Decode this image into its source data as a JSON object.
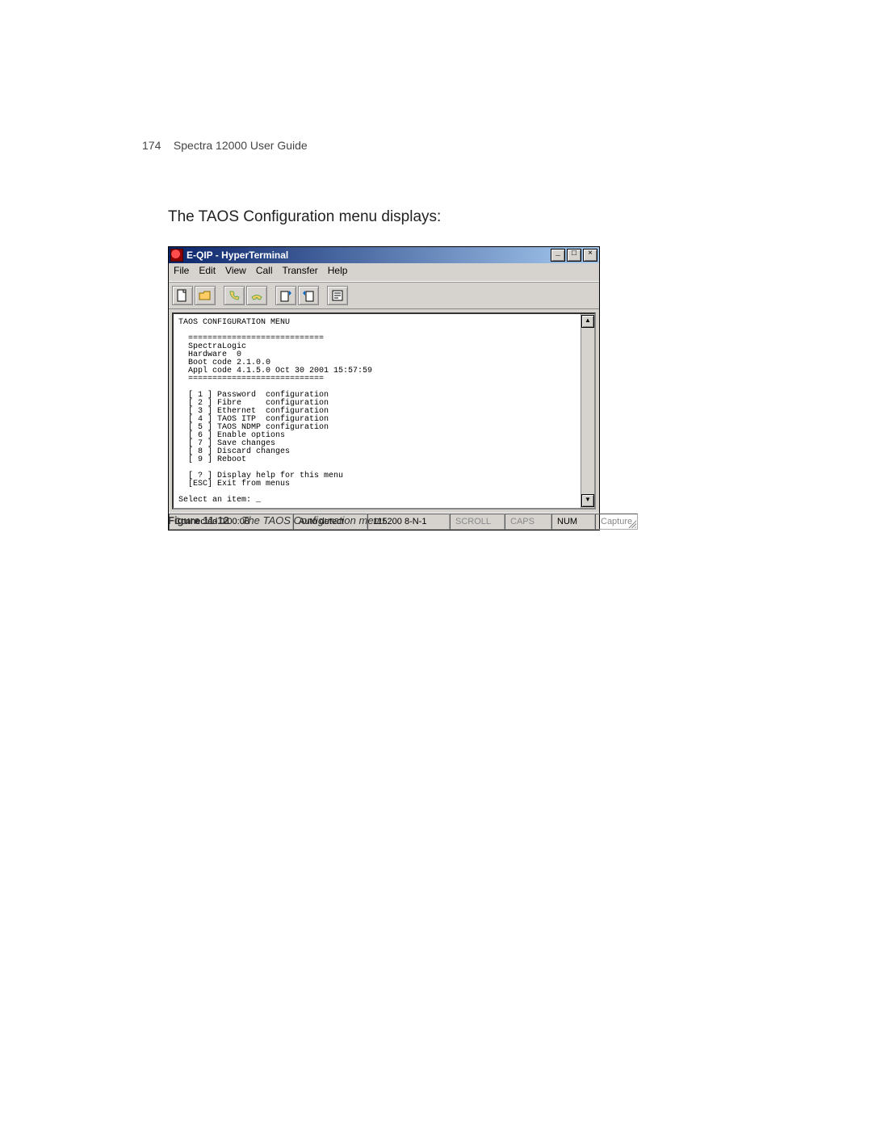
{
  "page": {
    "number": "174",
    "guide_title": "Spectra 12000 User Guide",
    "intro_text": "The TAOS Configuration menu displays:"
  },
  "window": {
    "title": "E-QIP - HyperTerminal",
    "menus": {
      "file": "File",
      "edit": "Edit",
      "view": "View",
      "call": "Call",
      "transfer": "Transfer",
      "help": "Help"
    },
    "titlebar_buttons": {
      "min": "_",
      "max": "□",
      "close": "×"
    },
    "scroll": {
      "up": "▲",
      "down": "▼"
    }
  },
  "terminal": {
    "text": "TAOS CONFIGURATION MENU\n\n  ============================\n  SpectraLogic\n  Hardware  0\n  Boot code 2.1.0.0\n  Appl code 4.1.5.0 Oct 30 2001 15:57:59\n  ============================\n\n  [ 1 ] Password  configuration\n  [ 2 ] Fibre     configuration\n  [ 3 ] Ethernet  configuration\n  [ 4 ] TAOS ITP  configuration\n  [ 5 ] TAOS NDMP configuration\n  [ 6 ] Enable options\n  [ 7 ] Save changes\n  [ 8 ] Discard changes\n  [ 9 ] Reboot\n\n  [ ? ] Display help for this menu\n  [ESC] Exit from menus\n\nSelect an item: _"
  },
  "statusbar": {
    "connected": "Connected 0:00:08",
    "detect": "Auto detect",
    "baud": "115200 8-N-1",
    "scroll": "SCROLL",
    "caps": "CAPS",
    "num": "NUM",
    "capture": "Capture"
  },
  "figure": {
    "label": "Figure 11-12",
    "caption": "The TAOS Configuration menu."
  },
  "icons": {
    "new": "new-file-icon",
    "open": "open-folder-icon",
    "call": "phone-icon",
    "hangup": "phone-hangup-icon",
    "send": "send-file-icon",
    "receive": "receive-file-icon",
    "properties": "properties-icon"
  }
}
